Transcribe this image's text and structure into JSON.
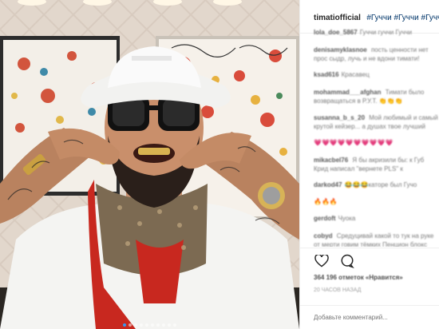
{
  "post": {
    "username": "timatiofficial",
    "hashtags": "#Гуччи #Гуччи #Гуччи"
  },
  "comments": [
    {
      "user": "lola_doe_5867",
      "text": "Гуччи гуччи Гуччи"
    },
    {
      "user": "denisamyklasnoe",
      "text": "пость ценности нет прос сыдр, лучь и не вдони тимати!"
    },
    {
      "user": "ksad616",
      "text": "Красавец"
    },
    {
      "user": "mohammad___afghan",
      "text": "Тимати было возвращаться в Р.У.Т.",
      "emoji": "👏👏👏"
    },
    {
      "user": "susanna_b_s_20",
      "text": "Мой любимый и самый крутой кейзер... а душах твое лучший"
    },
    {
      "user": "",
      "text": "",
      "emoji": "💗💗💗💗💗💗💗💗💗💗"
    },
    {
      "user": "mikacbel76",
      "text": "Я бы акризили бы: к Губ Крид написал \"вернете PLS\" к"
    },
    {
      "user": "darkod47",
      "text": "каторе был Гучо",
      "emoji": "😂😂😂"
    },
    {
      "user": "",
      "text": "",
      "emoji": "🔥🔥🔥"
    },
    {
      "user": "gerdoft",
      "text": "Чуока"
    },
    {
      "user": "cobyd",
      "text": "Средуцивай какой то тук на руке от мерти говим тёмких Пенцион блокс"
    }
  ],
  "actions": {
    "like_icon": "heart-icon",
    "comment_icon": "comment-icon"
  },
  "likes_text": "364 196 отметок «Нравится»",
  "date_text": "20 ЧАСОВ НАЗАД",
  "add_comment_placeholder": "Добавьте комментарий...",
  "carousel": {
    "count": 10,
    "active_index": 0
  },
  "colors": {
    "username": "#262626",
    "hashtag": "#003569",
    "carousel_active": "#3897f0"
  }
}
